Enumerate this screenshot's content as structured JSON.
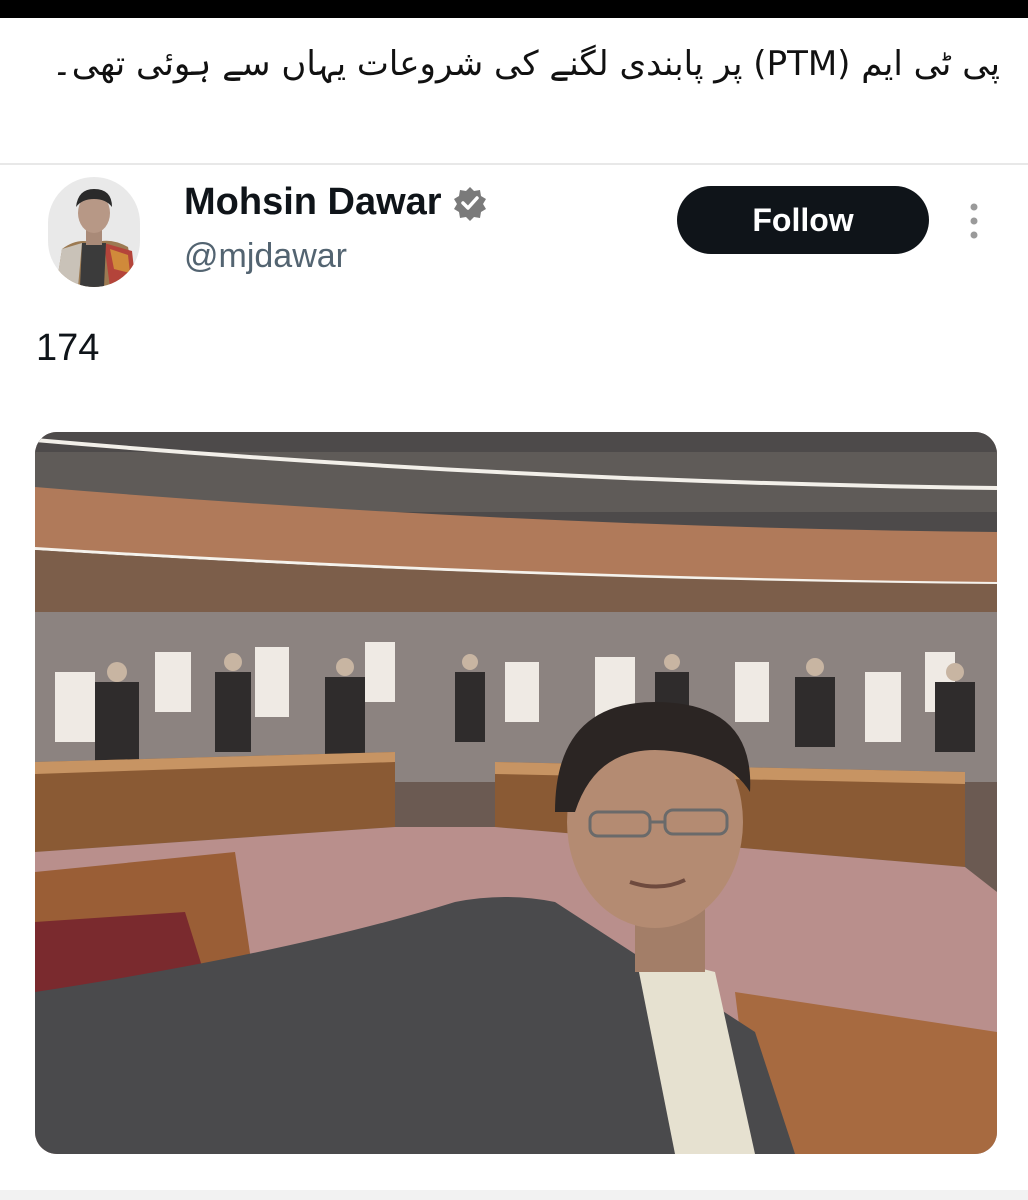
{
  "caption": {
    "text": "پی ٹی ایم (PTM) پر پابندی لگنے کی شروعات یہاں سے ہوئی تھی۔"
  },
  "tweet": {
    "author": {
      "display_name": "Mohsin Dawar",
      "handle": "@mjdawar",
      "verified": true,
      "avatar_icon": "profile-photo"
    },
    "follow_label": "Follow",
    "more_icon": "more-vertical-icon",
    "text": "174",
    "media": {
      "kind": "photo"
    }
  },
  "colors": {
    "verified": "#7a7a7a",
    "follow_bg": "#0f1419",
    "handle": "#536471"
  }
}
